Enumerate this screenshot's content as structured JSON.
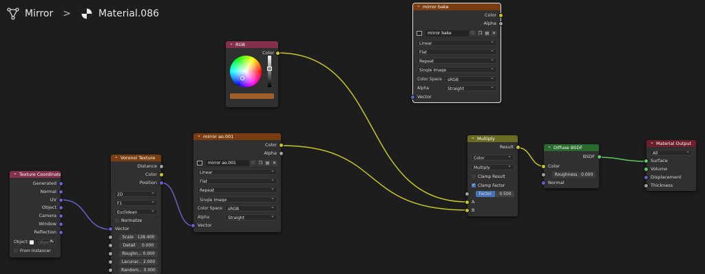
{
  "breadcrumb": {
    "object": "Mirror",
    "material": "Material.086",
    "sep": ">"
  },
  "colors": {
    "tex": "#7a3d12",
    "input": "#83314a",
    "converter": "#6a6b20",
    "shader": "#2b6a2e",
    "output": "#6d1f2c",
    "wire_color": "#c7c729",
    "wire_vector": "#6363c7",
    "wire_shader": "#63c763"
  },
  "nodes": {
    "texcoord": {
      "title": "Texture Coordinate",
      "outputs": [
        "Generated",
        "Normal",
        "UV",
        "Object",
        "Camera",
        "Window",
        "Reflection"
      ],
      "object_label": "Object:",
      "object_placeholder": "Object",
      "from_instancer": "From Instancer"
    },
    "voronoi": {
      "title": "Voronoi Texture",
      "outputs": [
        "Distance",
        "Color",
        "Position"
      ],
      "dims": "2D",
      "feature": "F1",
      "metric": "Euclidean",
      "normalize": "Normalize",
      "vector": "Vector",
      "scale_label": "Scale",
      "scale_value": "128.400",
      "detail_label": "Detail",
      "detail_value": "0.000",
      "rough_label": "Roughn...",
      "rough_value": "0.000",
      "lac_label": "Lacunar...",
      "lac_value": "2.000",
      "rand_label": "Random...",
      "rand_value": "0.000"
    },
    "rgb": {
      "title": "RGB",
      "output": "Color"
    },
    "ao": {
      "title": "mirror ao.001",
      "outputs": [
        "Color",
        "Alpha"
      ],
      "image": "mirror ao.001",
      "interp": "Linear",
      "proj": "Flat",
      "ext": "Repeat",
      "source": "Single Image",
      "cs_label": "Color Space",
      "cs_value": "sRGB",
      "alpha_label": "Alpha",
      "alpha_value": "Straight",
      "vector": "Vector"
    },
    "bake": {
      "title": "mirror bake",
      "outputs": [
        "Color",
        "Alpha"
      ],
      "image": "mirror bake",
      "interp": "Linear",
      "proj": "Flat",
      "ext": "Repeat",
      "source": "Single Image",
      "cs_label": "Color Space",
      "cs_value": "sRGB",
      "alpha_label": "Alpha",
      "alpha_value": "Straight",
      "vector": "Vector"
    },
    "multiply": {
      "title": "Multiply",
      "output": "Result",
      "type": "Color",
      "blend": "Multiply",
      "clamp_result": "Clamp Result",
      "clamp_factor": "Clamp Factor",
      "factor_label": "Factor",
      "factor_value": "0.500",
      "a": "A",
      "b": "B"
    },
    "diffuse": {
      "title": "Diffuse BSDF",
      "output": "BSDF",
      "color": "Color",
      "rough_label": "Roughness",
      "rough_value": "0.000",
      "normal": "Normal"
    },
    "matout": {
      "title": "Material Output",
      "target": "All",
      "inputs": [
        "Surface",
        "Volume",
        "Displacement",
        "Thickness"
      ]
    }
  }
}
